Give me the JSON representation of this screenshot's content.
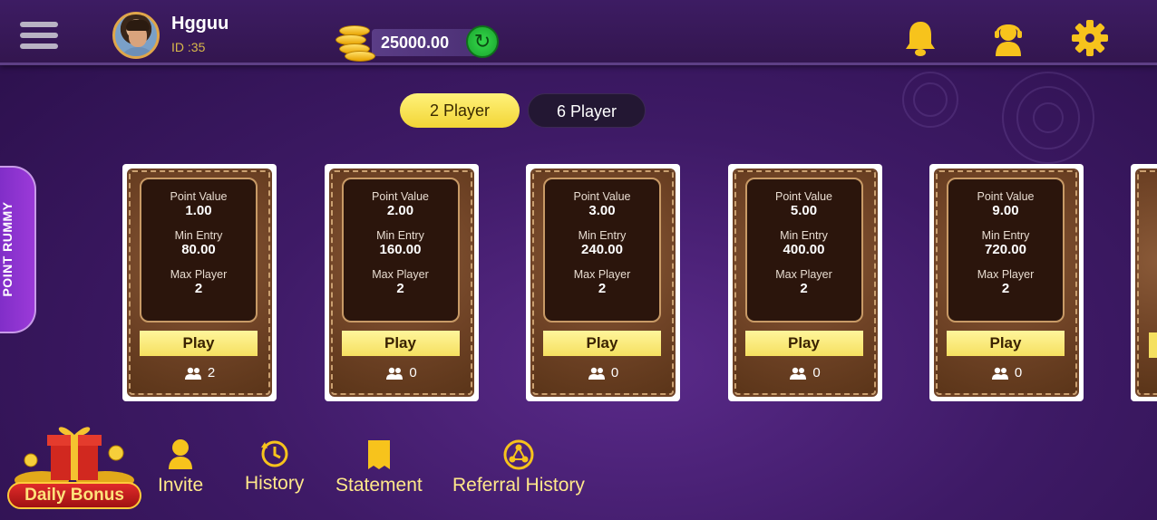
{
  "header": {
    "user_name": "Hgguu",
    "user_id": "ID :35",
    "balance": "25000.00"
  },
  "tabs": [
    {
      "label": "2 Player",
      "selected": true
    },
    {
      "label": "6 Player",
      "selected": false
    }
  ],
  "side_tab": {
    "label": "POINT RUMMY"
  },
  "cards": [
    {
      "point_value_label": "Point Value",
      "point_value": "1.00",
      "min_entry_label": "Min Entry",
      "min_entry": "80.00",
      "max_player_label": "Max Player",
      "max_player": "2",
      "play_label": "Play",
      "players": "2"
    },
    {
      "point_value_label": "Point Value",
      "point_value": "2.00",
      "min_entry_label": "Min Entry",
      "min_entry": "160.00",
      "max_player_label": "Max Player",
      "max_player": "2",
      "play_label": "Play",
      "players": "0"
    },
    {
      "point_value_label": "Point Value",
      "point_value": "3.00",
      "min_entry_label": "Min Entry",
      "min_entry": "240.00",
      "max_player_label": "Max Player",
      "max_player": "2",
      "play_label": "Play",
      "players": "0"
    },
    {
      "point_value_label": "Point Value",
      "point_value": "5.00",
      "min_entry_label": "Min Entry",
      "min_entry": "400.00",
      "max_player_label": "Max Player",
      "max_player": "2",
      "play_label": "Play",
      "players": "0"
    },
    {
      "point_value_label": "Point Value",
      "point_value": "9.00",
      "min_entry_label": "Min Entry",
      "min_entry": "720.00",
      "max_player_label": "Max Player",
      "max_player": "2",
      "play_label": "Play",
      "players": "0"
    }
  ],
  "bottom_nav": {
    "daily_bonus": "Daily Bonus",
    "invite": "Invite",
    "history": "History",
    "statement": "Statement",
    "referral_history": "Referral History"
  },
  "icons": {
    "menu": "hamburger-menu-icon",
    "coins": "coin-stack-icon",
    "refresh": "refresh-icon",
    "notifications": "bell-icon",
    "support": "headset-support-icon",
    "settings": "gear-icon",
    "players": "people-icon",
    "invite": "person-icon",
    "history": "clock-history-icon",
    "statement": "document-icon",
    "referral": "referral-network-icon"
  },
  "colors": {
    "accent_yellow": "#f5e060",
    "nav_text": "#ffe88a",
    "background": "#3e1a66",
    "card_brown": "#6e4225"
  }
}
